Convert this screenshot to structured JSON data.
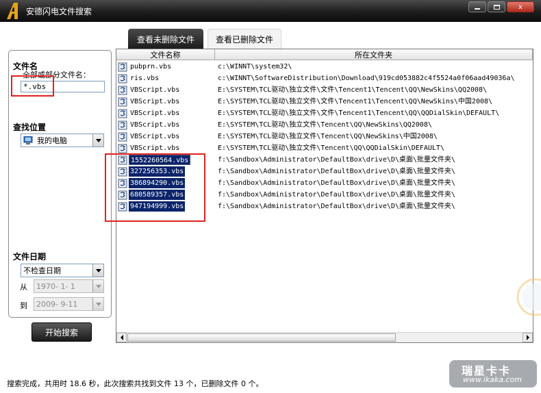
{
  "window": {
    "title": "安德闪电文件搜索",
    "min_glyph": "",
    "max_glyph": "",
    "close_glyph": "x"
  },
  "tabs": [
    {
      "label": "查看未删除文件",
      "active": true
    },
    {
      "label": "查看已删除文件",
      "active": false
    }
  ],
  "filename_section": {
    "heading": "文件名",
    "hint": "全部或部分文件名：",
    "value": "*.vbs"
  },
  "location_section": {
    "heading": "查找位置",
    "selected": "我的电脑"
  },
  "date_section": {
    "heading": "文件日期",
    "mode": "不检查日期",
    "from_label": "从",
    "from_value": "1970- 1- 1",
    "to_label": "到",
    "to_value": "2009- 9-11"
  },
  "search_button": "开始搜索",
  "list": {
    "columns": [
      "文件名称",
      "所在文件夹"
    ],
    "rows": [
      {
        "name": "pubprn.vbs",
        "folder": "c:\\WINNT\\system32\\",
        "selected": false
      },
      {
        "name": "ris.vbs",
        "folder": "c:\\WINNT\\SoftwareDistribution\\Download\\919cd053882c4f5524a0f06aad49036a\\",
        "selected": false
      },
      {
        "name": "VBScript.vbs",
        "folder": "E:\\SYSTEM\\TCL驱动\\独立文件\\文件\\Tencent1\\Tencent\\QQ\\NewSkins\\QQ2008\\",
        "selected": false
      },
      {
        "name": "VBScript.vbs",
        "folder": "E:\\SYSTEM\\TCL驱动\\独立文件\\文件\\Tencent1\\Tencent\\QQ\\NewSkins\\中国2008\\",
        "selected": false
      },
      {
        "name": "VBScript.vbs",
        "folder": "E:\\SYSTEM\\TCL驱动\\独立文件\\文件\\Tencent1\\Tencent\\QQ\\QQDialSkin\\DEFAULT\\",
        "selected": false
      },
      {
        "name": "VBScript.vbs",
        "folder": "E:\\SYSTEM\\TCL驱动\\独立文件\\Tencent\\QQ\\NewSkins\\QQ2008\\",
        "selected": false
      },
      {
        "name": "VBScript.vbs",
        "folder": "E:\\SYSTEM\\TCL驱动\\独立文件\\Tencent\\QQ\\NewSkins\\中国2008\\",
        "selected": false
      },
      {
        "name": "VBScript.vbs",
        "folder": "E:\\SYSTEM\\TCL驱动\\独立文件\\Tencent\\QQ\\QQDialSkin\\DEFAULT\\",
        "selected": false
      },
      {
        "name": "1552260564.vbs",
        "folder": "f:\\Sandbox\\Administrator\\DefaultBox\\drive\\D\\桌面\\批量文件夹\\",
        "selected": true
      },
      {
        "name": "327256353.vbs",
        "folder": "f:\\Sandbox\\Administrator\\DefaultBox\\drive\\D\\桌面\\批量文件夹\\",
        "selected": true
      },
      {
        "name": "386894290.vbs",
        "folder": "f:\\Sandbox\\Administrator\\DefaultBox\\drive\\D\\桌面\\批量文件夹\\",
        "selected": true
      },
      {
        "name": "680589357.vbs",
        "folder": "f:\\Sandbox\\Administrator\\DefaultBox\\drive\\D\\桌面\\批量文件夹\\",
        "selected": true
      },
      {
        "name": "947194999.vbs",
        "folder": "f:\\Sandbox\\Administrator\\DefaultBox\\drive\\D\\桌面\\批量文件夹\\",
        "selected": true
      }
    ]
  },
  "status": "搜索完成，共用时 18.6 秒，此次搜索共找到文件 13 个，已删除文件 0 个。",
  "watermark": {
    "main": "瑞星卡卡",
    "sub": "www.ikaka.com"
  },
  "colors": {
    "selection": "#0a246a",
    "annotation_red": "#e02020",
    "titlebar": "#1d1d1d"
  }
}
